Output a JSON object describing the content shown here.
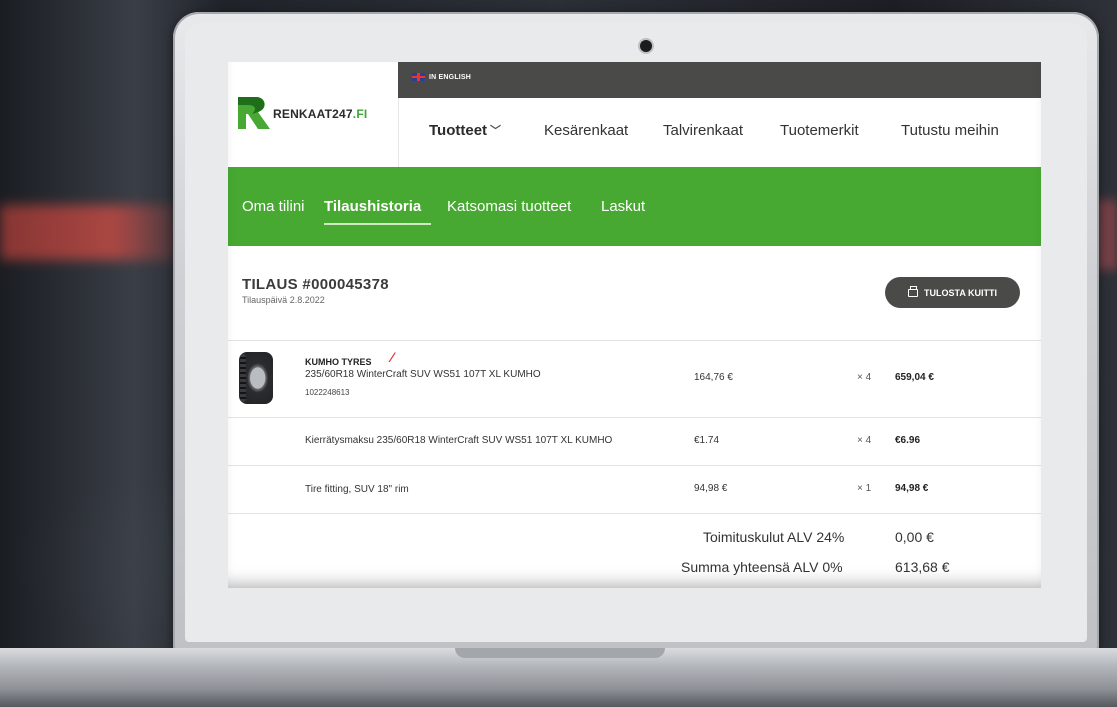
{
  "lang_label": "IN ENGLISH",
  "brand": {
    "name": "RENKAAT247",
    "suffix": ".FI",
    "green": "#47a832",
    "dark": "#4a4a48"
  },
  "main_nav": [
    {
      "label": "Tuotteet"
    },
    {
      "label": "Kesärenkaat"
    },
    {
      "label": "Talvirenkaat"
    },
    {
      "label": "Tuotemerkit"
    },
    {
      "label": "Tutustu meihin"
    }
  ],
  "account_nav": [
    {
      "label": "Oma tilini"
    },
    {
      "label": "Tilaushistoria",
      "active": true
    },
    {
      "label": "Katsomasi tuotteet"
    },
    {
      "label": "Laskut"
    }
  ],
  "order": {
    "title": "TILAUS #000045378",
    "date": "Tilauspäivä 2.8.2022",
    "print_label": "TULOSTA KUITTI",
    "items": [
      {
        "brand": "KUMHO TYRES",
        "name": "235/60R18 WinterCraft SUV WS51 107T XL KUMHO",
        "sku": "1022248613",
        "price": "164,76 €",
        "qty": "× 4",
        "total": "659,04 €"
      },
      {
        "name": "Kierrätysmaksu 235/60R18 WinterCraft SUV WS51 107T XL KUMHO",
        "price": "€1.74",
        "qty": "× 4",
        "total": "€6.96"
      },
      {
        "name": "Tire fitting, SUV 18\" rim",
        "price": "94,98 €",
        "qty": "× 1",
        "total": "94,98 €"
      }
    ],
    "summary": [
      {
        "label": "Toimituskulut ALV 24%",
        "value": "0,00 €"
      },
      {
        "label": "Summa yhteensä ALV 0%",
        "value": "613,68 €"
      }
    ]
  }
}
